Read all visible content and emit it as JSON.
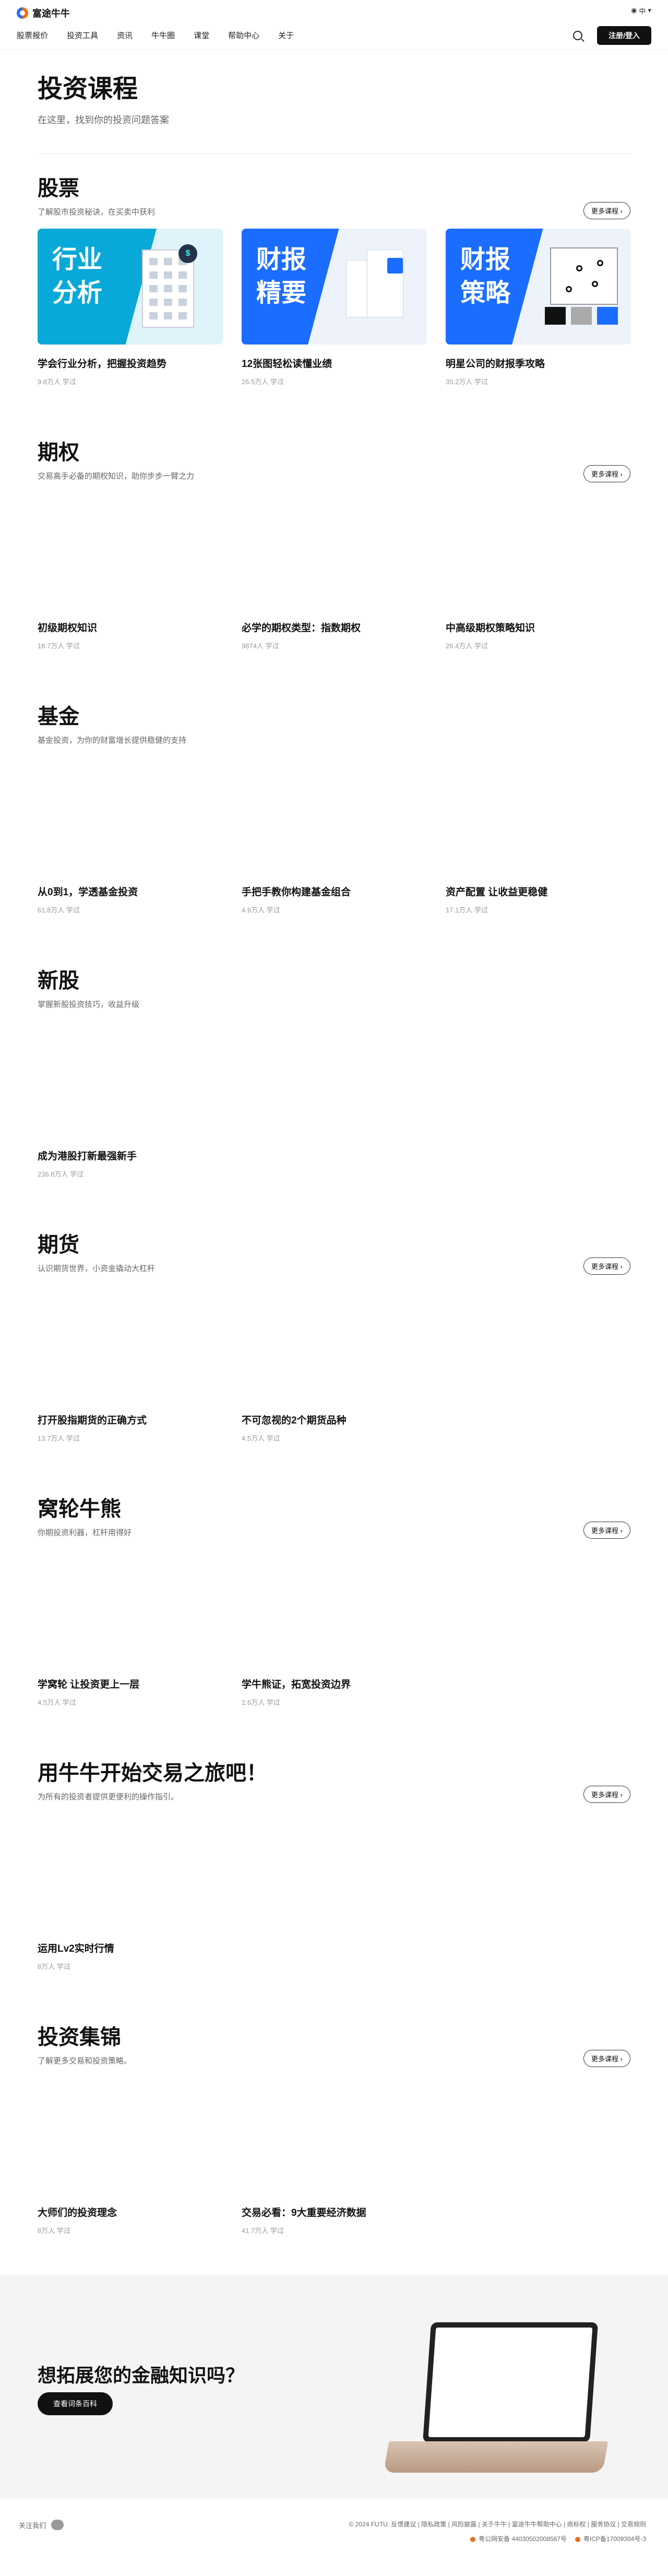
{
  "top": {
    "lang": "中"
  },
  "nav": {
    "brand": "富途牛牛",
    "links": [
      "股票报价",
      "投资工具",
      "资讯",
      "牛牛圈",
      "课堂",
      "帮助中心",
      "关于"
    ],
    "login": "注册/登入"
  },
  "header": {
    "title": "投资课程",
    "subtitle": "在这里，找到你的投资问题答案"
  },
  "more_label": "更多课程",
  "sections": [
    {
      "title": "股票",
      "subtitle": "了解股市投资秘诀，在买卖中获利",
      "cards": [
        {
          "title": "学会行业分析，把握投资趋势",
          "meta": "9.8万人 学过",
          "thumb_text": "行业\n分析"
        },
        {
          "title": "12张图轻松读懂业绩",
          "meta": "26.5万人 学过",
          "thumb_text": "财报\n精要"
        },
        {
          "title": "明星公司的财报季攻略",
          "meta": "35.2万人 学过",
          "thumb_text": "财报\n策略"
        }
      ]
    },
    {
      "title": "期权",
      "subtitle": "交易高手必备的期权知识，助你步步一臂之力",
      "cards": [
        {
          "title": "初级期权知识",
          "meta": "18.7万人 学过"
        },
        {
          "title": "必学的期权类型：指数期权",
          "meta": "9874人 学过"
        },
        {
          "title": "中高级期权策略知识",
          "meta": "26.4万人 学过"
        }
      ]
    },
    {
      "title": "基金",
      "subtitle": "基金投资，为你的财富增长提供稳健的支持",
      "cards": [
        {
          "title": "从0到1，学透基金投资",
          "meta": "61.8万人 学过"
        },
        {
          "title": "手把手教你构建基金组合",
          "meta": "4.9万人 学过"
        },
        {
          "title": "资产配置 让收益更稳健",
          "meta": "17.1万人 学过"
        }
      ]
    },
    {
      "title": "新股",
      "subtitle": "掌握新股投资技巧，收益升级",
      "cards": [
        {
          "title": "成为港股打新最强新手",
          "meta": "236.8万人 学过"
        }
      ]
    },
    {
      "title": "期货",
      "subtitle": "认识期货世界，小资金撬动大杠杆",
      "cards": [
        {
          "title": "打开股指期货的正确方式",
          "meta": "13.7万人 学过"
        },
        {
          "title": "不可忽视的2个期货品种",
          "meta": "4.5万人 学过"
        }
      ]
    },
    {
      "title": "窝轮牛熊",
      "subtitle": "你期投资利器，杠杆用得好",
      "cards": [
        {
          "title": "学窝轮 让投资更上一层",
          "meta": "4.5万人 学过"
        },
        {
          "title": "学牛熊证，拓宽投资边界",
          "meta": "2.6万人 学过"
        }
      ]
    },
    {
      "title": "用牛牛开始交易之旅吧！",
      "subtitle": "为所有的投资者提供更便利的操作指引。",
      "cards": [
        {
          "title": "运用Lv2实时行情",
          "meta": "8万人 学过"
        }
      ]
    },
    {
      "title": "投资集锦",
      "subtitle": "了解更多交易和投资策略。",
      "cards": [
        {
          "title": "大师们的投资理念",
          "meta": "8万人 学过"
        },
        {
          "title": "交易必看：9大重要经济数据",
          "meta": "41.7万人 学过"
        }
      ]
    }
  ],
  "promo": {
    "title": "想拓展您的金融知识吗？",
    "button": "查看词条百科"
  },
  "footer": {
    "follow": "关注我们",
    "links": "© 2024 FUTU. 反馈建议 | 隐私政策 | 风险披露 | 关于牛牛 | 富途牛牛帮助中心 | 商标权 | 服务协议 | 交易规则",
    "reg1": "粤公网安备 44030502008587号",
    "reg2": "粤ICP备17009304号-3"
  }
}
